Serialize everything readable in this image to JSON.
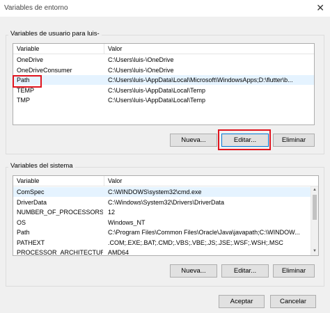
{
  "window": {
    "title": "Variables de entorno",
    "close_glyph": "✕"
  },
  "user_vars": {
    "group_label": "Variables de usuario para luis-",
    "columns": [
      "Variable",
      "Valor"
    ],
    "rows": [
      {
        "name": "OneDrive",
        "value": "C:\\Users\\luis-\\OneDrive"
      },
      {
        "name": "OneDriveConsumer",
        "value": "C:\\Users\\luis-\\OneDrive"
      },
      {
        "name": "Path",
        "value": "C:\\Users\\luis-\\AppData\\Local\\Microsoft\\WindowsApps;D:\\flutter\\b..."
      },
      {
        "name": "TEMP",
        "value": "C:\\Users\\luis-\\AppData\\Local\\Temp"
      },
      {
        "name": "TMP",
        "value": "C:\\Users\\luis-\\AppData\\Local\\Temp"
      }
    ],
    "selected_row": 2,
    "buttons": {
      "new": "Nueva...",
      "edit": "Editar...",
      "delete": "Eliminar"
    }
  },
  "system_vars": {
    "group_label": "Variables del sistema",
    "columns": [
      "Variable",
      "Valor"
    ],
    "rows": [
      {
        "name": "ComSpec",
        "value": "C:\\WINDOWS\\system32\\cmd.exe"
      },
      {
        "name": "DriverData",
        "value": "C:\\Windows\\System32\\Drivers\\DriverData"
      },
      {
        "name": "NUMBER_OF_PROCESSORS",
        "value": "12"
      },
      {
        "name": "OS",
        "value": "Windows_NT"
      },
      {
        "name": "Path",
        "value": "C:\\Program Files\\Common Files\\Oracle\\Java\\javapath;C:\\WINDOW..."
      },
      {
        "name": "PATHEXT",
        "value": ".COM;.EXE;.BAT;.CMD;.VBS;.VBE;.JS;.JSE;.WSF;.WSH;.MSC"
      },
      {
        "name": "PROCESSOR_ARCHITECTURE",
        "value": "AMD64"
      }
    ],
    "selected_row": 0,
    "buttons": {
      "new": "Nueva...",
      "edit": "Editar...",
      "delete": "Eliminar"
    }
  },
  "footer": {
    "accept": "Aceptar",
    "cancel": "Cancelar"
  },
  "colors": {
    "highlight": "#e0141e",
    "selection": "#e5f3ff",
    "focus_border": "#0078d7"
  }
}
